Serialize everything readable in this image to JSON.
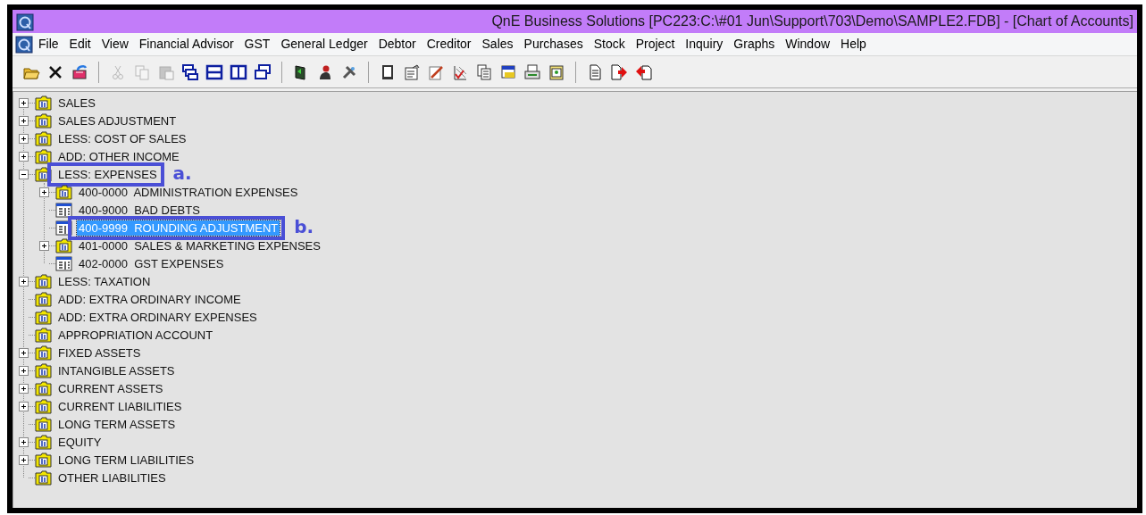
{
  "window": {
    "title": "QnE Business Solutions [PC223:C:\\#01 Jun\\Support\\703\\Demo\\SAMPLE2.FDB] - [Chart of Accounts]"
  },
  "menu": [
    "File",
    "Edit",
    "View",
    "Financial Advisor",
    "GST",
    "General Ledger",
    "Debtor",
    "Creditor",
    "Sales",
    "Purchases",
    "Stock",
    "Project",
    "Inquiry",
    "Graphs",
    "Window",
    "Help"
  ],
  "toolbar": [
    {
      "kind": "button",
      "disabled": false
    },
    {
      "kind": "button",
      "disabled": false
    },
    {
      "kind": "button",
      "disabled": false
    },
    {
      "kind": "separator"
    },
    {
      "kind": "button",
      "disabled": true
    },
    {
      "kind": "button",
      "disabled": true
    },
    {
      "kind": "button",
      "disabled": true
    },
    {
      "kind": "button",
      "disabled": false
    },
    {
      "kind": "button",
      "disabled": false
    },
    {
      "kind": "button",
      "disabled": false
    },
    {
      "kind": "button",
      "disabled": false
    },
    {
      "kind": "separator"
    },
    {
      "kind": "button",
      "disabled": false
    },
    {
      "kind": "button",
      "disabled": false
    },
    {
      "kind": "button",
      "disabled": false
    },
    {
      "kind": "separator"
    },
    {
      "kind": "button",
      "disabled": false
    },
    {
      "kind": "button",
      "disabled": false
    },
    {
      "kind": "button",
      "disabled": false
    },
    {
      "kind": "button",
      "disabled": false
    },
    {
      "kind": "button",
      "disabled": false
    },
    {
      "kind": "button",
      "disabled": false
    },
    {
      "kind": "button",
      "disabled": false
    },
    {
      "kind": "button",
      "disabled": false
    },
    {
      "kind": "separator"
    },
    {
      "kind": "button",
      "disabled": false
    },
    {
      "kind": "button",
      "disabled": false
    },
    {
      "kind": "button",
      "disabled": false
    }
  ],
  "tree": [
    {
      "label": "SALES",
      "kind": "group",
      "expanded": false,
      "selected": false
    },
    {
      "label": "SALES ADJUSTMENT",
      "kind": "group",
      "expanded": false,
      "selected": false
    },
    {
      "label": "LESS: COST OF SALES",
      "kind": "group",
      "expanded": false,
      "selected": false
    },
    {
      "label": "ADD: OTHER INCOME",
      "kind": "group",
      "expanded": false,
      "selected": false
    },
    {
      "label": "LESS: EXPENSES",
      "kind": "group",
      "expanded": true,
      "selected": false,
      "annotation": "a.",
      "children": [
        {
          "label": "400-0000  ADMINISTRATION EXPENSES",
          "kind": "group",
          "expanded": false,
          "selected": false
        },
        {
          "label": "400-9000  BAD DEBTS",
          "kind": "account",
          "selected": false
        },
        {
          "label": "400-9999  ROUNDING ADJUSTMENT",
          "kind": "account",
          "selected": true,
          "annotation": "b."
        },
        {
          "label": "401-0000  SALES & MARKETING EXPENSES",
          "kind": "group",
          "expanded": false,
          "selected": false
        },
        {
          "label": "402-0000  GST EXPENSES",
          "kind": "account",
          "selected": false
        }
      ]
    },
    {
      "label": "LESS: TAXATION",
      "kind": "group",
      "expanded": false,
      "selected": false
    },
    {
      "label": "ADD: EXTRA ORDINARY INCOME",
      "kind": "group",
      "selected": false
    },
    {
      "label": "ADD: EXTRA ORDINARY EXPENSES",
      "kind": "group",
      "selected": false
    },
    {
      "label": "APPROPRIATION ACCOUNT",
      "kind": "group",
      "selected": false
    },
    {
      "label": "FIXED ASSETS",
      "kind": "group",
      "expanded": false,
      "selected": false
    },
    {
      "label": "INTANGIBLE ASSETS",
      "kind": "group",
      "expanded": false,
      "selected": false
    },
    {
      "label": "CURRENT ASSETS",
      "kind": "group",
      "expanded": false,
      "selected": false
    },
    {
      "label": "CURRENT LIABILITIES",
      "kind": "group",
      "expanded": false,
      "selected": false
    },
    {
      "label": "LONG TERM ASSETS",
      "kind": "group",
      "selected": false
    },
    {
      "label": "EQUITY",
      "kind": "group",
      "expanded": false,
      "selected": false
    },
    {
      "label": "LONG TERM LIABILITIES",
      "kind": "group",
      "expanded": false,
      "selected": false
    },
    {
      "label": "OTHER LIABILITIES",
      "kind": "group",
      "selected": false
    }
  ]
}
